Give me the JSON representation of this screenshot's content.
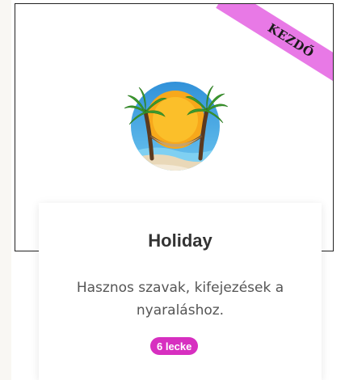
{
  "course": {
    "level_ribbon": "KEZDŐ",
    "title": "Holiday",
    "description": "Hasznos szavak, kifejezések a nyaraláshoz.",
    "lessons_badge": "6 lecke",
    "icon": "beach-hammock-palm-icon"
  },
  "colors": {
    "ribbon": "#e879e6",
    "badge": "#d72fc0",
    "sky": "#3ea8e6",
    "sun": "#f7a81b",
    "sand": "#e9d8b8",
    "palm_leaf": "#3c9a2e"
  }
}
